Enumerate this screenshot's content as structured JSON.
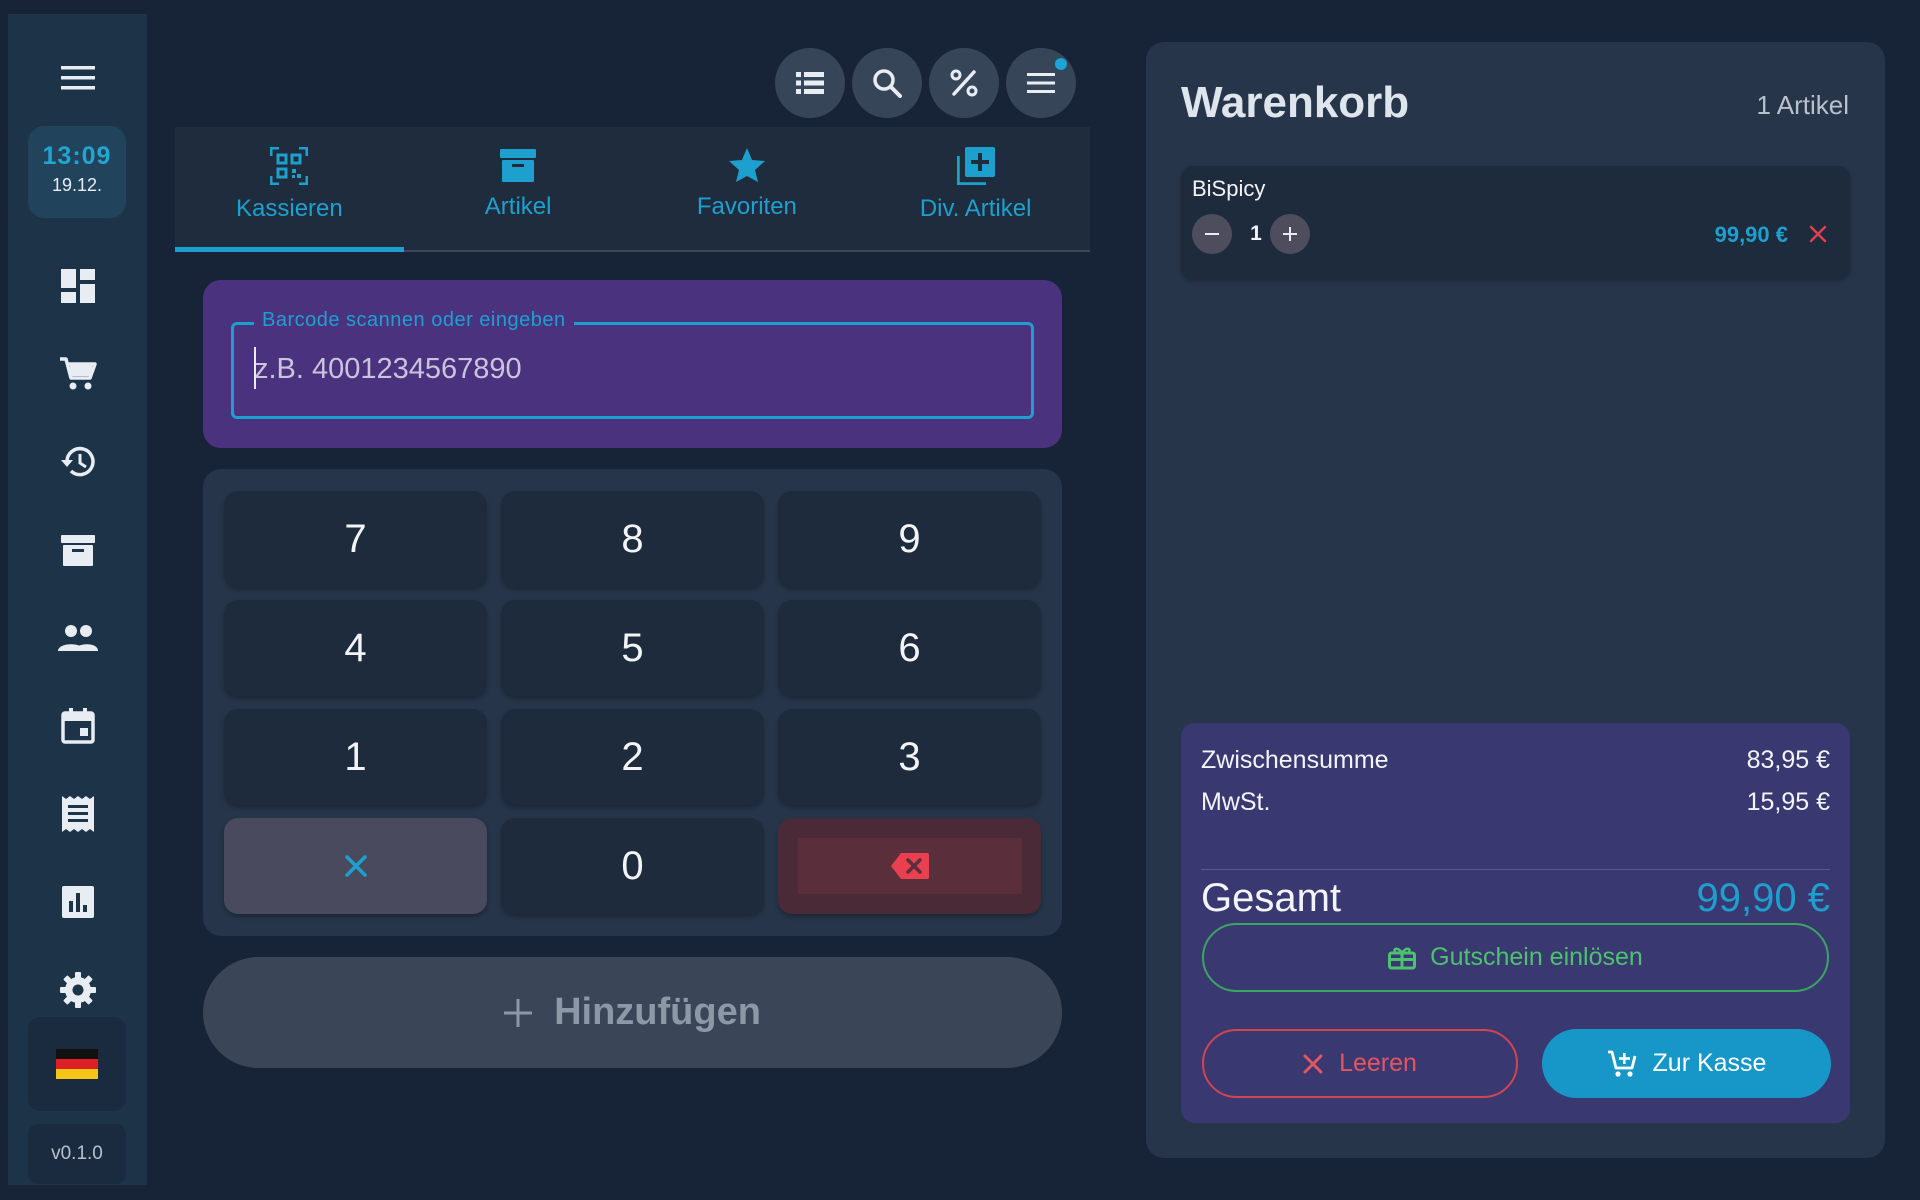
{
  "sidebar": {
    "clock_time": "13:09",
    "clock_date": "19.12.",
    "items": [
      "menu",
      "dashboard",
      "cart",
      "history",
      "archive",
      "customers",
      "calendar",
      "receipts",
      "reports",
      "settings"
    ],
    "language_flag": "de",
    "version": "v0.1.0"
  },
  "toolbar": {
    "buttons": [
      "list-icon",
      "search-icon",
      "percent-icon",
      "menu-icon"
    ],
    "notification": true
  },
  "tabs": [
    {
      "label": "Kassieren",
      "icon": "qr-scan-icon",
      "active": true
    },
    {
      "label": "Artikel",
      "icon": "archive-box-icon",
      "active": false
    },
    {
      "label": "Favoriten",
      "icon": "star-icon",
      "active": false
    },
    {
      "label": "Div. Artikel",
      "icon": "add-box-icon",
      "active": false
    }
  ],
  "barcode": {
    "label": "Barcode scannen oder eingeben",
    "placeholder": "z.B. 4001234567890",
    "value": ""
  },
  "keypad": {
    "keys": [
      "7",
      "8",
      "9",
      "4",
      "5",
      "6",
      "1",
      "2",
      "3",
      "×",
      "0",
      "⌫"
    ]
  },
  "add_button": {
    "label": "Hinzufügen"
  },
  "cart": {
    "title": "Warenkorb",
    "count": "1 Artikel",
    "items": [
      {
        "name": "BiSpicy",
        "quantity": "1",
        "price": "99,90 €"
      }
    ],
    "subtotal_label": "Zwischensumme",
    "subtotal_value": "83,95 €",
    "tax_label": "MwSt.",
    "tax_value": "15,95 €",
    "total_label": "Gesamt",
    "total_value": "99,90 €",
    "voucher_label": "Gutschein einlösen",
    "clear_label": "Leeren",
    "checkout_label": "Zur Kasse"
  },
  "colors": {
    "accent": "#1ea0cf",
    "background": "#172337",
    "panel": "#263549",
    "barcode_card": "#4b327f",
    "summary": "#3a3870",
    "success": "#4cc270",
    "danger": "#e25563"
  }
}
